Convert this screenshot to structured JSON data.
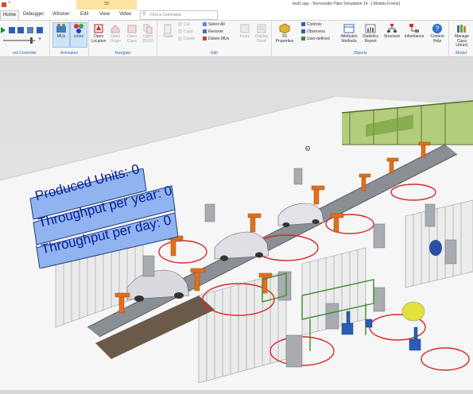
{
  "window": {
    "title": "test2.spp - Tecnomatix Plant Simulation 14 - [.Models.Frame]",
    "context_tab": "3D"
  },
  "tabs": [
    "Home",
    "Debugger",
    "Window",
    "Edit",
    "View",
    "Video"
  ],
  "search": {
    "placeholder": "Find a Command"
  },
  "ribbon": {
    "event_controller": {
      "label": "ent Controller"
    },
    "animation": {
      "label": "Animation",
      "mus": "MUs",
      "icons": "Icons"
    },
    "navigate": {
      "label": "Navigate",
      "open_location": "Open Location",
      "open_origin": "Open Origin",
      "open_class": "Open Class",
      "open_2d3d": "Open 2D/3D"
    },
    "edit": {
      "label": "Edit",
      "paste": "Paste",
      "cut": "Cut",
      "copy": "Copy",
      "delete": "Delete",
      "select_all": "Select All",
      "rename": "Rename",
      "delete_mus": "Delete MUs",
      "icons": "Icons",
      "display_panel": "Display Panel"
    },
    "objects": {
      "label": "Objects",
      "properties_3d": "3D Properties",
      "controls": "Controls",
      "observers": "Observers",
      "user_defined": "User-defined",
      "attributes_methods": "Attributes Methods",
      "statistics_report": "Statistics Report",
      "structure": "Structure",
      "inheritance": "Inheritance",
      "context_help": "Context Help"
    },
    "model": {
      "label": "Model",
      "manage_class_library": "Manage Class Library"
    }
  },
  "scene": {
    "board": {
      "produced_units": "Produced Units: 0",
      "throughput_year": "Throughput per year: 0",
      "throughput_day": "Throughput per day: 0"
    }
  },
  "colors": {
    "accent": "#2b6cb0",
    "board": "#8fb4ef",
    "robot": "#e0701c",
    "floor": "#f4f4f4"
  }
}
